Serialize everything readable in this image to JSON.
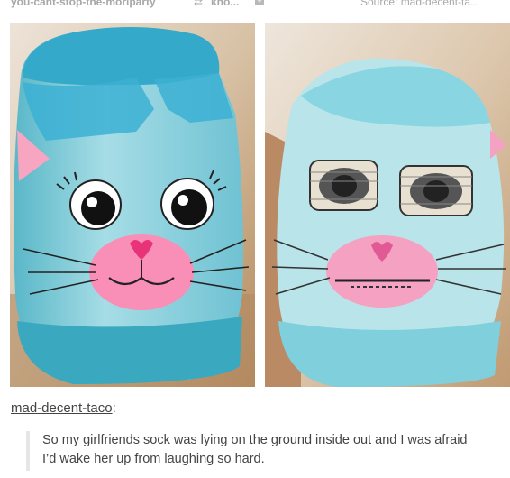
{
  "header": {
    "via_blog": "you-cant-stop-the-moriparty",
    "reblog_icon": "reblog-icon",
    "via_blog_2": "kno...",
    "plus_icon": "plus-icon",
    "source": "Source: mad-decent-ta..."
  },
  "images": [
    {
      "name": "photo-sock-outside",
      "colors": {
        "sock": "#8fd3e0",
        "cuff": "#3bb0cf",
        "nose": "#f98fb6",
        "bg": "#d9b88f"
      }
    },
    {
      "name": "photo-sock-inside-out",
      "colors": {
        "sock": "#b9e4ea",
        "nose": "#f4a1c2",
        "bg": "#c7a27a"
      }
    }
  ],
  "post": {
    "author": "mad-decent-taco",
    "author_suffix": ":",
    "quote_line_1": "So my girlfriends sock was lying on the ground inside out and I was afraid",
    "quote_line_2": "I’d wake her up from laughing so hard."
  }
}
